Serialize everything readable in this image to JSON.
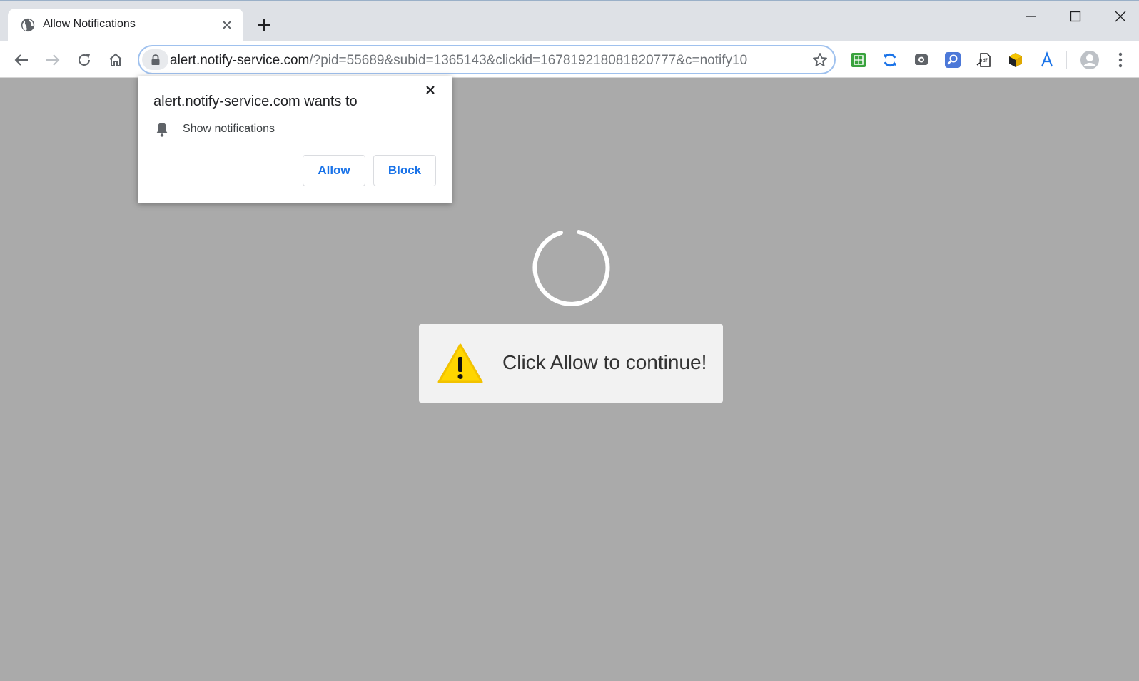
{
  "browser": {
    "tab": {
      "title": "Allow Notifications",
      "favicon": "globe-icon"
    },
    "address": {
      "host": "alert.notify-service.com",
      "path": "/?pid=55689&subid=1365143&clickid=167819218081820777&c=notify10"
    },
    "extensions": [
      "sheets-extension-icon",
      "sync-extension-icon",
      "screenshot-extension-icon",
      "search-extension-icon",
      "pdf-extension-icon",
      "box-extension-icon",
      "font-extension-icon"
    ]
  },
  "permission_prompt": {
    "title": "alert.notify-service.com wants to",
    "item": "Show notifications",
    "allow_label": "Allow",
    "block_label": "Block"
  },
  "page": {
    "message": "Click Allow to continue!"
  },
  "colors": {
    "page_background": "#aaaaaa",
    "link_blue": "#1a73e8",
    "warning_yellow": "#ffd600"
  }
}
